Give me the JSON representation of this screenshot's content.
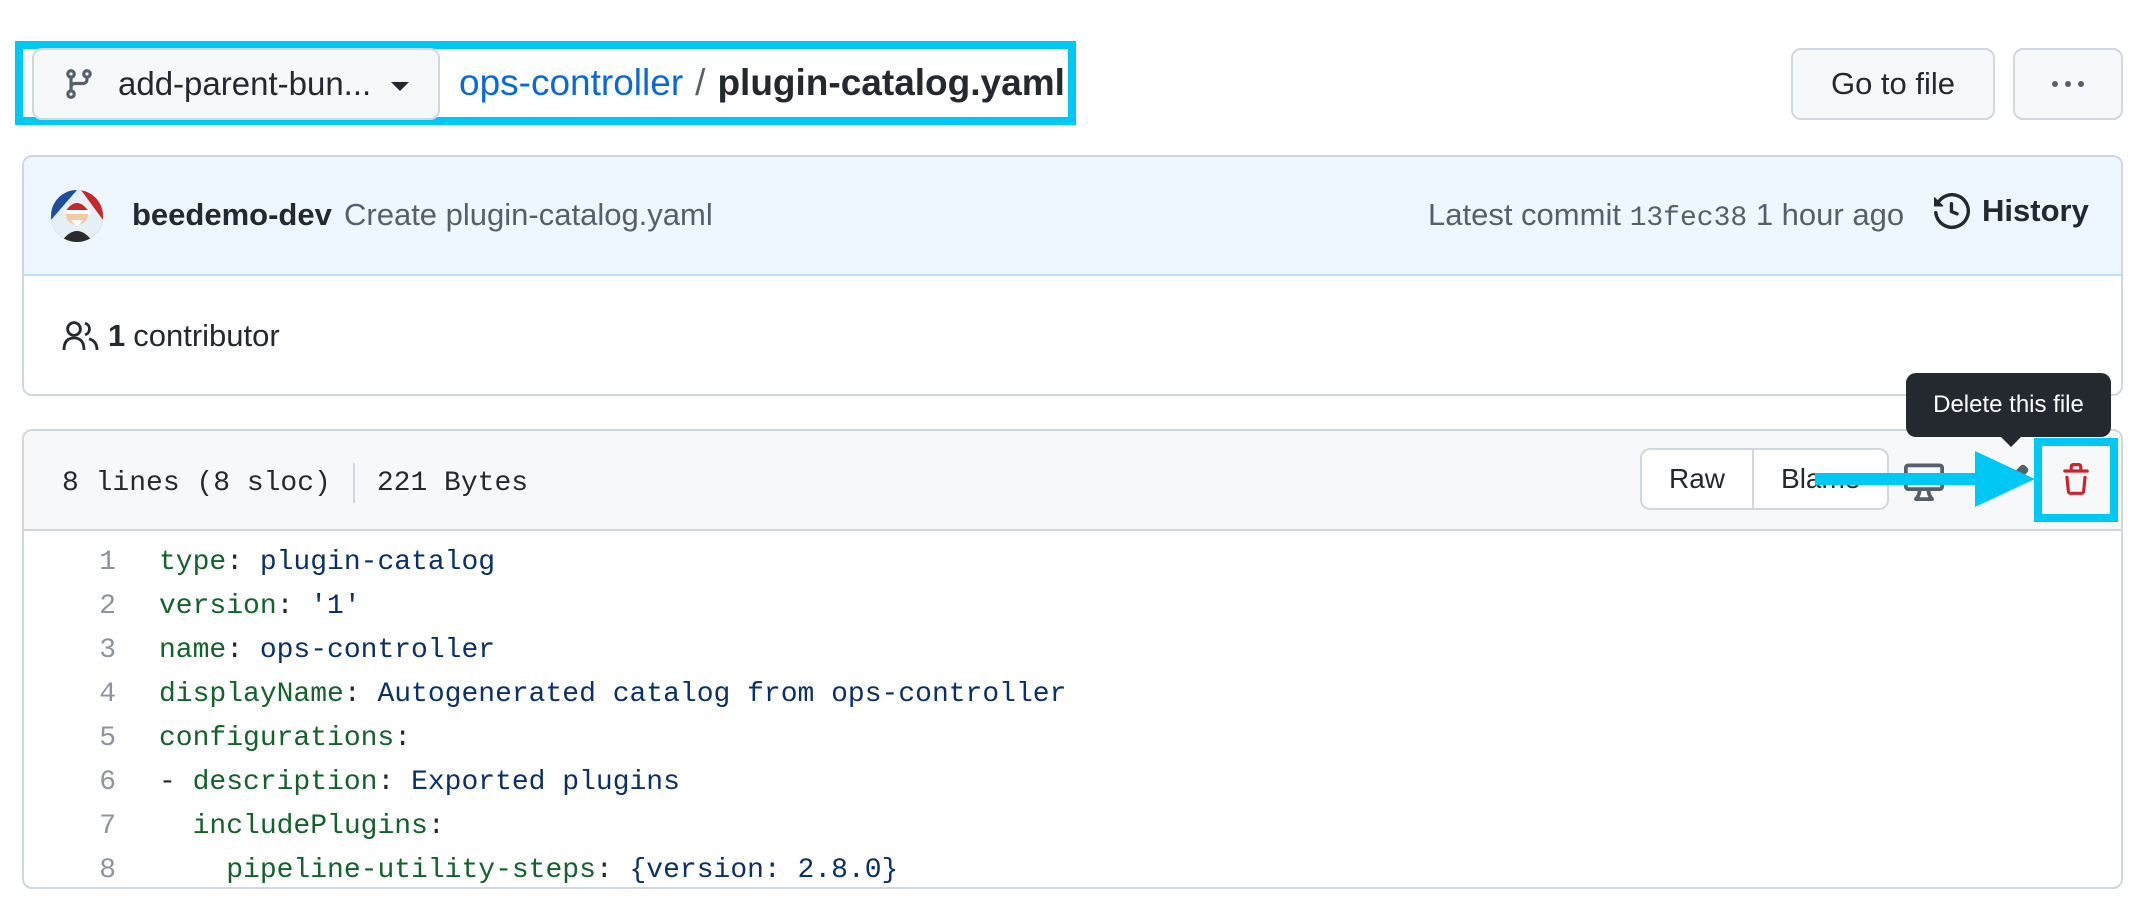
{
  "header": {
    "branch_name": "add-parent-bun...",
    "breadcrumb_repo": "ops-controller",
    "breadcrumb_separator": "/",
    "breadcrumb_file": "plugin-catalog.yaml",
    "goto_file_label": "Go to file"
  },
  "commit": {
    "author": "beedemo-dev",
    "message": "Create plugin-catalog.yaml",
    "latest_label": "Latest commit",
    "sha": "13fec38",
    "time": "1 hour ago",
    "history_label": "History"
  },
  "contributors": {
    "count": "1",
    "label": "contributor"
  },
  "file": {
    "lines_info": "8 lines (8 sloc)",
    "size": "221 Bytes",
    "raw_label": "Raw",
    "blame_label": "Blame",
    "tooltip": "Delete this file"
  },
  "code_lines": [
    {
      "num": "1",
      "indent": "",
      "key": "type",
      "colon": ": ",
      "value": "plugin-catalog"
    },
    {
      "num": "2",
      "indent": "",
      "key": "version",
      "colon": ": ",
      "value": "'1'"
    },
    {
      "num": "3",
      "indent": "",
      "key": "name",
      "colon": ": ",
      "value": "ops-controller"
    },
    {
      "num": "4",
      "indent": "",
      "key": "displayName",
      "colon": ": ",
      "value": "Autogenerated catalog from ops-controller"
    },
    {
      "num": "5",
      "indent": "",
      "key": "configurations",
      "colon": ":",
      "value": ""
    },
    {
      "num": "6",
      "indent": "- ",
      "key": "description",
      "colon": ": ",
      "value": "Exported plugins"
    },
    {
      "num": "7",
      "indent": "  ",
      "key": "includePlugins",
      "colon": ":",
      "value": ""
    },
    {
      "num": "8",
      "indent": "    ",
      "key": "pipeline-utility-steps",
      "colon": ": ",
      "value": "{version: 2.8.0}"
    }
  ],
  "colors": {
    "highlight": "#00c8f5",
    "link": "#0969da",
    "danger": "#cf222e",
    "yaml_key": "#116329",
    "yaml_value": "#0a3069"
  },
  "icons": {
    "branch": "git-branch-icon",
    "history": "history-icon",
    "contributors": "people-icon",
    "desktop": "desktop-icon",
    "edit": "pencil-icon",
    "delete": "trash-icon",
    "more": "kebab-horizontal-icon"
  }
}
